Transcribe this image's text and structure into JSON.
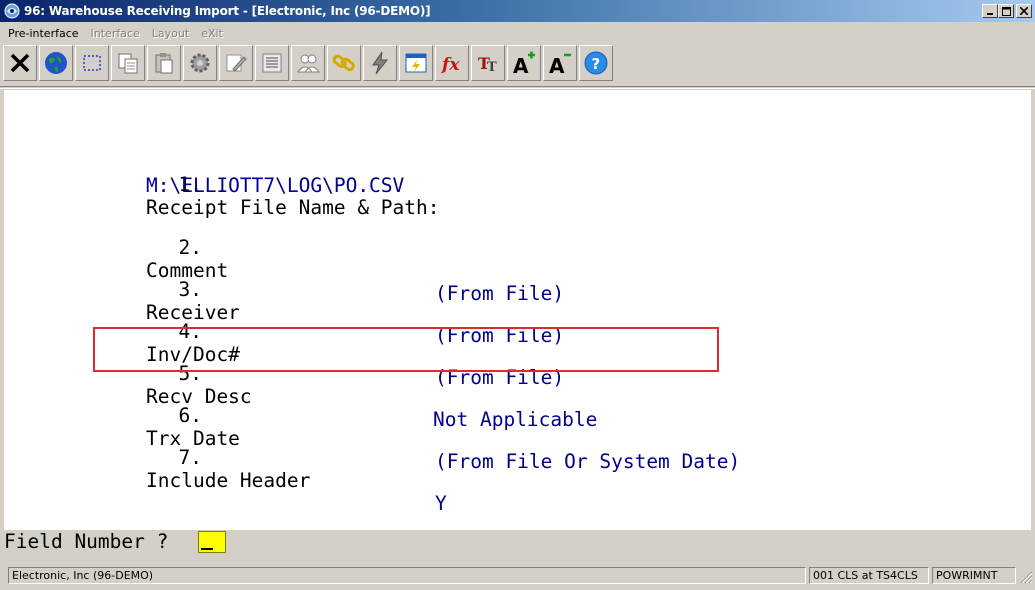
{
  "window": {
    "title": "96: Warehouse Receiving Import - [Electronic, Inc (96-DEMO)]",
    "buttons": {
      "minimize": "_",
      "maximize": "□",
      "close": "×"
    }
  },
  "menu": [
    {
      "label": "Pre-interface",
      "enabled": true
    },
    {
      "label": "Interface",
      "enabled": false
    },
    {
      "label": "Layout",
      "enabled": false
    },
    {
      "label": "eXit",
      "enabled": false
    }
  ],
  "toolbar": [
    {
      "icon": "close-x-icon"
    },
    {
      "icon": "globe-icon"
    },
    {
      "icon": "selection-box-icon"
    },
    {
      "icon": "copy-icon"
    },
    {
      "icon": "paste-icon"
    },
    {
      "icon": "settings-gear-icon"
    },
    {
      "icon": "edit-icon"
    },
    {
      "icon": "list-icon"
    },
    {
      "icon": "users-icon"
    },
    {
      "icon": "link-icon"
    },
    {
      "icon": "lightning-icon"
    },
    {
      "icon": "window-script-icon"
    },
    {
      "icon": "fx-function-icon"
    },
    {
      "icon": "font-style-icon"
    },
    {
      "icon": "font-increase-icon"
    },
    {
      "icon": "font-decrease-icon"
    },
    {
      "icon": "help-icon"
    }
  ],
  "form": {
    "fields": [
      {
        "num": "1.",
        "label": "Receipt File Name & Path:",
        "value": ""
      },
      {
        "num": "2.",
        "label": "Comment",
        "value": "(From File)"
      },
      {
        "num": "3.",
        "label": "Receiver",
        "value": "(From File)"
      },
      {
        "num": "4.",
        "label": "Inv/Doc#",
        "value": "(From File)"
      },
      {
        "num": "5.",
        "label": "Recv Desc",
        "value": "Not Applicable"
      },
      {
        "num": "6.",
        "label": "Trx Date",
        "value": "(From File Or System Date)"
      },
      {
        "num": "7.",
        "label": "Include Header",
        "value": "Y"
      }
    ],
    "path_value": "M:\\ELLIOTT7\\LOG\\PO.CSV"
  },
  "prompt": {
    "text": "Field Number ?",
    "value": ""
  },
  "status": {
    "company": "Electronic, Inc (96-DEMO)",
    "session": "001 CLS at TS4CLS",
    "user": "POWRIMNT"
  }
}
